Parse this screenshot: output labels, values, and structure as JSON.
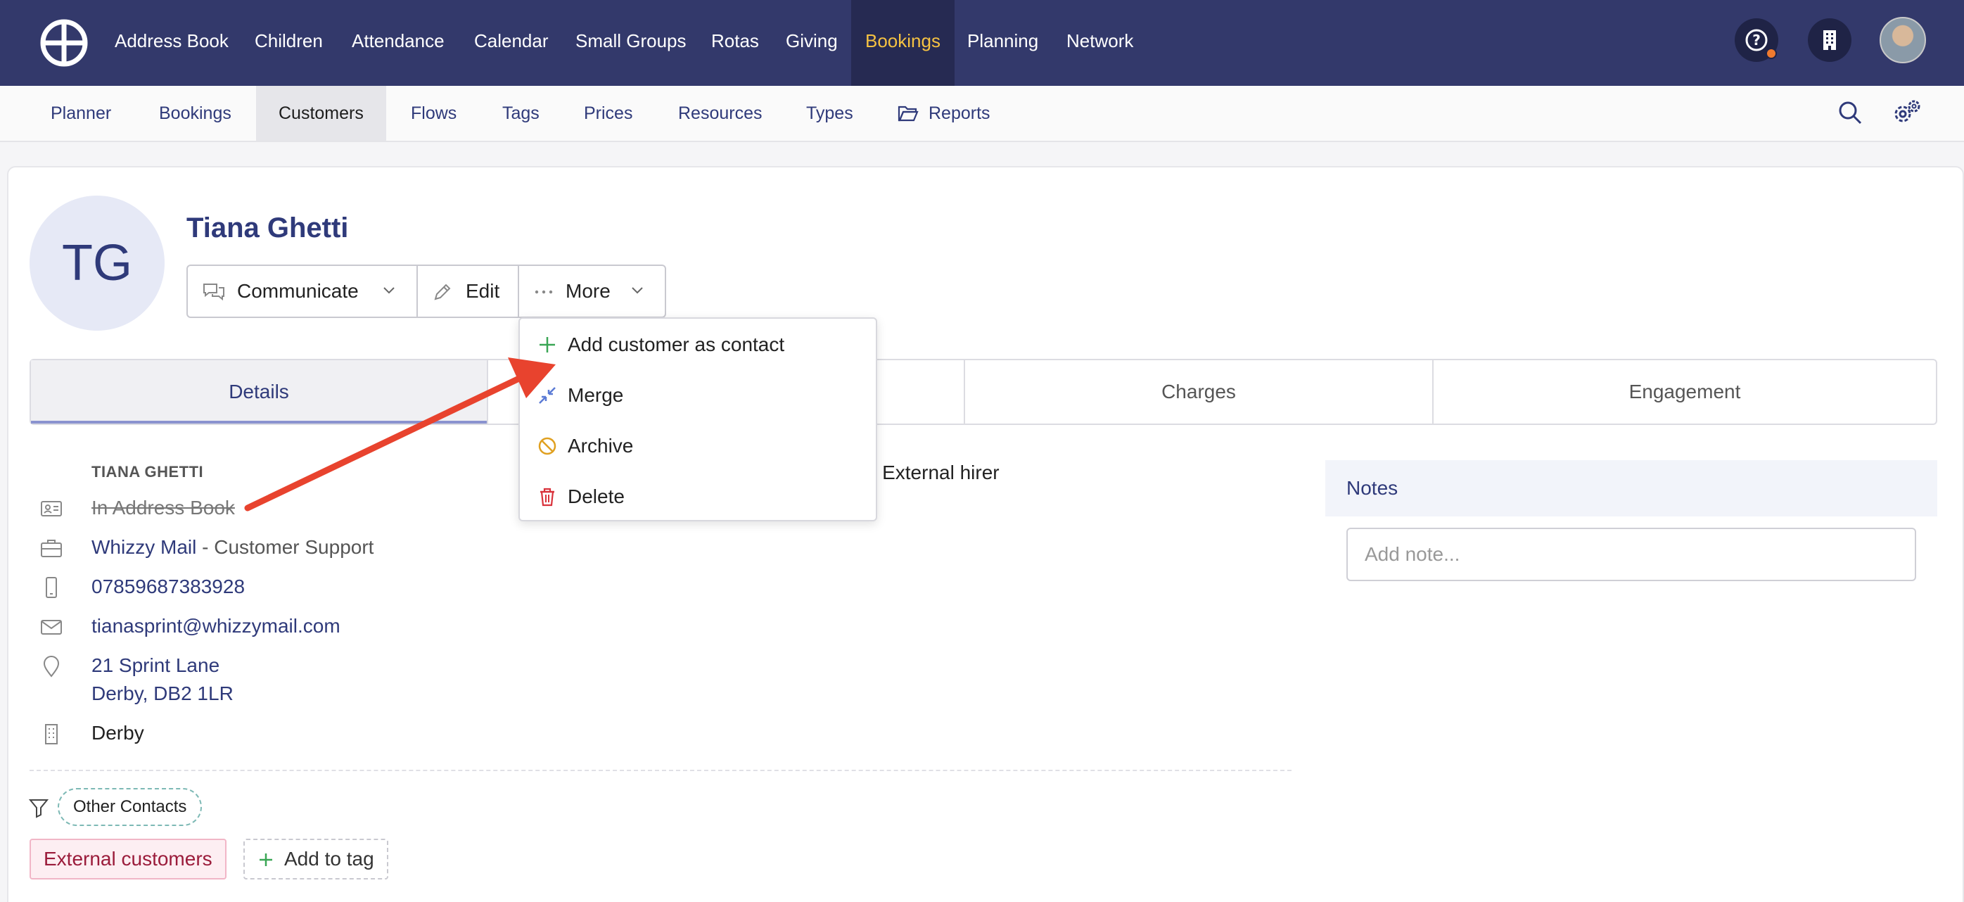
{
  "topnav": {
    "items": [
      {
        "label": "Address Book"
      },
      {
        "label": "Children"
      },
      {
        "label": "Attendance"
      },
      {
        "label": "Calendar"
      },
      {
        "label": "Small Groups"
      },
      {
        "label": "Rotas"
      },
      {
        "label": "Giving"
      },
      {
        "label": "Bookings",
        "active": true
      },
      {
        "label": "Planning"
      },
      {
        "label": "Network"
      }
    ],
    "icons": [
      "help-icon",
      "building-icon",
      "user-avatar"
    ]
  },
  "subnav": {
    "items": [
      {
        "label": "Planner"
      },
      {
        "label": "Bookings"
      },
      {
        "label": "Customers",
        "active": true
      },
      {
        "label": "Flows"
      },
      {
        "label": "Tags"
      },
      {
        "label": "Prices"
      },
      {
        "label": "Resources"
      },
      {
        "label": "Types"
      },
      {
        "label": "Reports"
      }
    ],
    "icons": [
      "search-icon",
      "settings-icon"
    ]
  },
  "customer": {
    "initials": "TG",
    "name": "Tiana Ghetti",
    "section_label": "TIANA GHETTI",
    "address_book": "In Address Book",
    "company": "Whizzy Mail",
    "role": " - Customer Support",
    "phone": "07859687383928",
    "email": "tianasprint@whizzymail.com",
    "address_line1": "21 Sprint Lane",
    "address_line2": "Derby, DB2 1LR",
    "site": "Derby",
    "type_suffix": "- External hirer"
  },
  "actions": {
    "communicate": "Communicate",
    "edit": "Edit",
    "more": "More"
  },
  "more_menu": [
    {
      "label": "Add customer as contact",
      "icon": "plus-icon",
      "color": "#3aa655"
    },
    {
      "label": "Merge",
      "icon": "merge-icon",
      "color": "#5b7bd5"
    },
    {
      "label": "Archive",
      "icon": "archive-icon",
      "color": "#e0a020"
    },
    {
      "label": "Delete",
      "icon": "trash-icon",
      "color": "#d9323b"
    }
  ],
  "tabs": [
    {
      "label": "Details",
      "active": true
    },
    {
      "label": "Charges"
    },
    {
      "label": "Engagement"
    }
  ],
  "filter_chip": "Other Contacts",
  "tags": {
    "existing": "External customers",
    "add": "Add to tag"
  },
  "notes": {
    "title": "Notes",
    "placeholder": "Add note..."
  },
  "colors": {
    "nav_bg": "#33396b",
    "accent": "#f5c242",
    "link": "#2f3a7a",
    "annotation_arrow": "#e8432e"
  }
}
